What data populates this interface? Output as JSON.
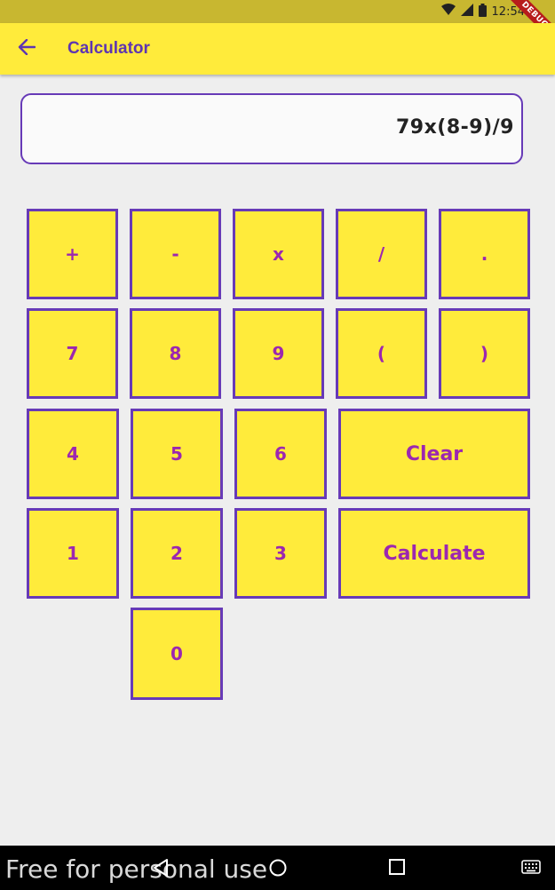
{
  "status_bar": {
    "time": "12:54",
    "debug_label": "DEBUG"
  },
  "app_bar": {
    "title": "Calculator"
  },
  "display": {
    "expression": "79x(8-9)/9"
  },
  "keypad": {
    "plus": "+",
    "minus": "-",
    "multiply": "x",
    "divide": "/",
    "dot": ".",
    "seven": "7",
    "eight": "8",
    "nine": "9",
    "open_paren": "(",
    "close_paren": ")",
    "four": "4",
    "five": "5",
    "six": "6",
    "clear": "Clear",
    "one": "1",
    "two": "2",
    "three": "3",
    "calculate": "Calculate",
    "zero": "0"
  },
  "watermark": "Free for personal use",
  "colors": {
    "accent": "#FFEB3B",
    "border": "#673AB7",
    "key_text": "#9C27B0",
    "background": "#EEEEEE"
  }
}
